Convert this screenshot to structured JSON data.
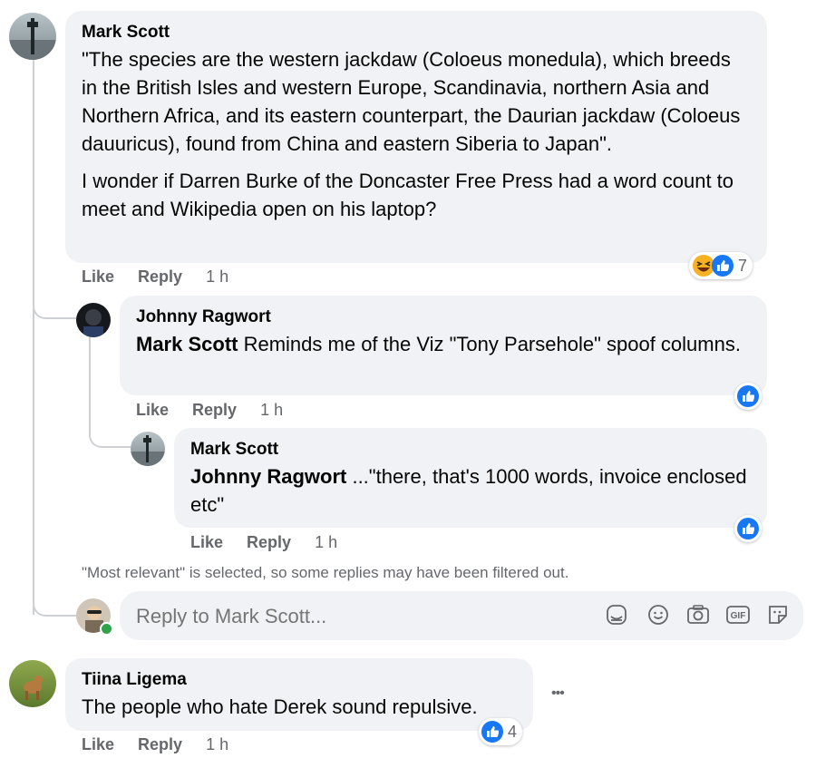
{
  "comments": [
    {
      "author": "Mark Scott",
      "paragraphs": [
        "\"The species are the western jackdaw (Coloeus monedula), which breeds in the British Isles and western Europe, Scandinavia, northern Asia and Northern Africa, and its eastern counterpart, the Daurian jackdaw (Coloeus dauuricus), found from China and eastern Siberia to Japan\".",
        "I wonder if Darren Burke of the Doncaster Free Press had a word count to meet and Wikipedia open on his laptop?"
      ],
      "like": "Like",
      "reply": "Reply",
      "time": "1 h",
      "reaction_count": "7"
    },
    {
      "author": "Johnny Ragwort",
      "mention": "Mark Scott",
      "text": " Reminds me of the Viz \"Tony Parsehole\" spoof columns.",
      "like": "Like",
      "reply": "Reply",
      "time": "1 h"
    },
    {
      "author": "Mark Scott",
      "mention": "Johnny Ragwort",
      "text": " ...\"there, that's 1000 words, invoice enclosed etc\"",
      "like": "Like",
      "reply": "Reply",
      "time": "1 h"
    },
    {
      "author": "Tiina Ligema",
      "text": "The people who hate Derek sound repulsive.",
      "like": "Like",
      "reply": "Reply",
      "time": "1 h",
      "reaction_count": "4"
    }
  ],
  "filter_notice": "\"Most relevant\" is selected, so some replies may have been filtered out.",
  "reply_input": {
    "placeholder": "Reply to Mark Scott..."
  },
  "tools": [
    "sticker-icon",
    "emoji-icon",
    "camera-icon",
    "gif-icon",
    "sticker-face-icon"
  ],
  "tool_gif_label": "GIF",
  "more_menu": "•••",
  "colors": {
    "bubble": "#f0f2f5",
    "like_blue": "#1877f2",
    "meta": "#65676b",
    "online": "#31a24c"
  }
}
